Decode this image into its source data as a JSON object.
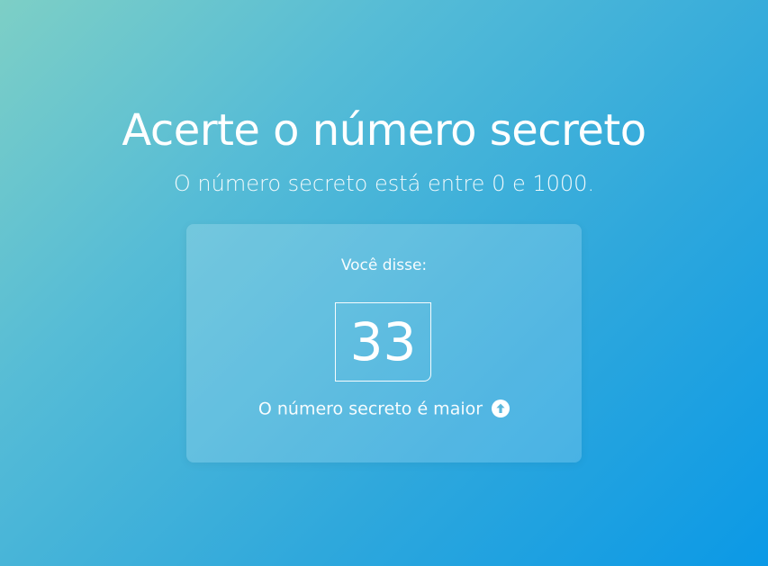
{
  "header": {
    "title": "Acerte o número secreto",
    "subtitle": "O número secreto está entre 0 e 1000."
  },
  "card": {
    "label": "Você disse:",
    "guess": "33",
    "hint": "O número secreto é maior",
    "hint_icon": "arrow-up-circle-icon"
  },
  "colors": {
    "gradient_start": "#7dcfc6",
    "gradient_end": "#0b99e6",
    "text": "#ffffff"
  }
}
